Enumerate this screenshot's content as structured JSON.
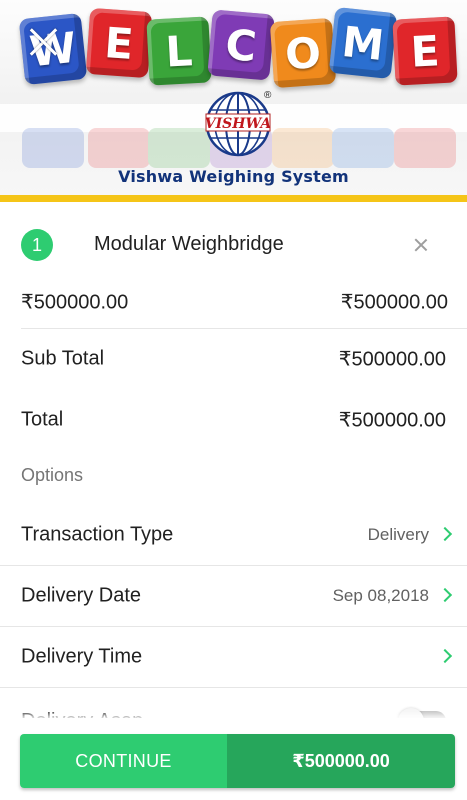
{
  "header": {
    "banner_letters": [
      "W",
      "E",
      "L",
      "C",
      "O",
      "M",
      "E"
    ],
    "banner_colors": [
      "#2b56c6",
      "#e0262a",
      "#3aa53a",
      "#7f3bb5",
      "#f08a1c",
      "#2b6fd0",
      "#e0262a"
    ],
    "logo_text": "VISHWA",
    "registered_mark": "®",
    "company_name": "Vishwa Weighing System",
    "accent_color": "#f5c518",
    "close_icon": "close-icon"
  },
  "cart_item": {
    "quantity": "1",
    "name": "Modular Weighbridge",
    "unit_price": "₹500000.00",
    "line_total": "₹500000.00"
  },
  "summary": {
    "subtotal_label": "Sub Total",
    "subtotal_value": "₹500000.00",
    "total_label": "Total",
    "total_value": "₹500000.00"
  },
  "options": {
    "header": "Options",
    "transaction_type": {
      "label": "Transaction Type",
      "value": "Delivery"
    },
    "delivery_date": {
      "label": "Delivery Date",
      "value": "Sep 08,2018"
    },
    "delivery_time": {
      "label": "Delivery Time",
      "value": ""
    },
    "delivery_asap": {
      "label": "Delivery Asap",
      "enabled": false
    }
  },
  "footer": {
    "continue_label": "CONTINUE",
    "total_value": "₹500000.00",
    "primary_color": "#2ecc71",
    "secondary_color": "#26a65b"
  }
}
